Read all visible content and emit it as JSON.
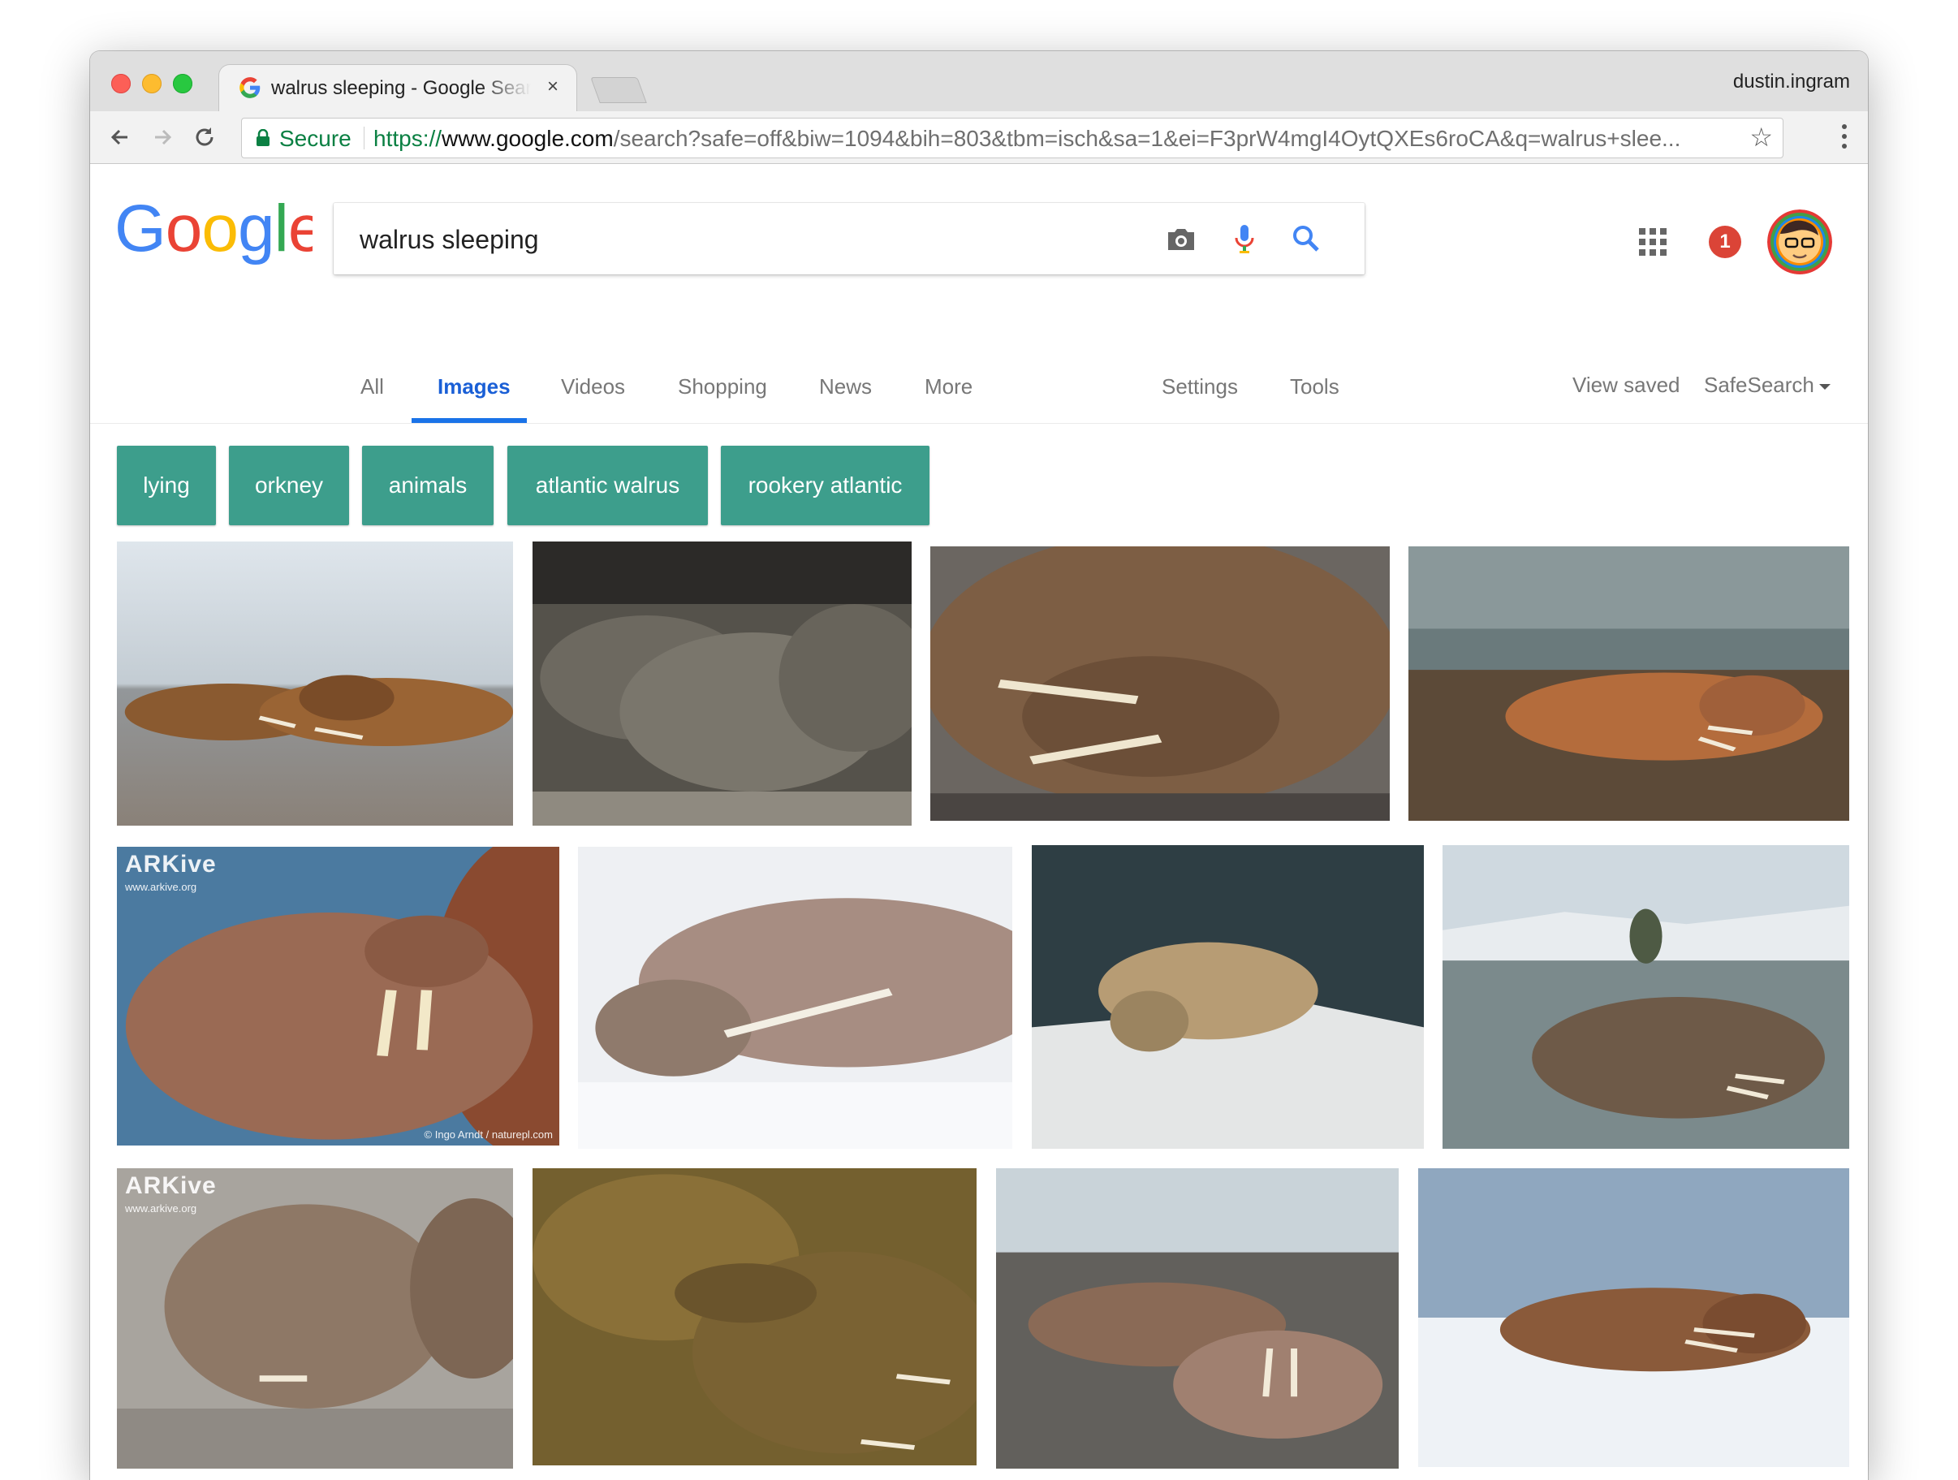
{
  "browser": {
    "tab_title": "walrus sleeping - Google Search",
    "tab_close": "×",
    "profile_name": "dustin.ingram",
    "secure_label": "Secure",
    "url_scheme": "https://",
    "url_host": "www.google.com",
    "url_rest": "/search?safe=off&biw=1094&bih=803&tbm=isch&sa=1&ei=F3prW4mgI4OytQXEs6roCA&q=walrus+slee...",
    "star": "☆"
  },
  "search": {
    "query": "walrus sleeping",
    "notification_count": "1"
  },
  "tabs": {
    "all": "All",
    "images": "Images",
    "videos": "Videos",
    "shopping": "Shopping",
    "news": "News",
    "more": "More",
    "settings": "Settings",
    "tools": "Tools",
    "view_saved": "View saved",
    "safesearch": "SafeSearch"
  },
  "chips": [
    "lying",
    "orkney",
    "animals",
    "atlantic walrus",
    "rookery atlantic"
  ],
  "watermarks": {
    "arkive": "ARKive",
    "arkive_url": "www.arkive.org",
    "credit": "© Ingo Arndt / naturepl.com"
  },
  "colors": {
    "secure_green": "#0b8043",
    "google_blue": "#4285f4",
    "chip_teal": "#3d9e8c",
    "active_tab": "#1a73e8"
  }
}
